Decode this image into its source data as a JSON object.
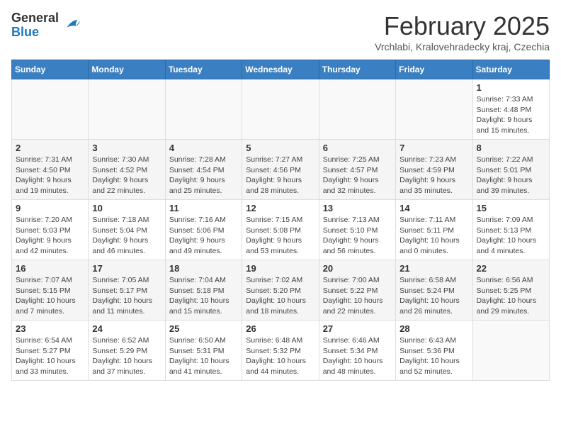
{
  "header": {
    "logo_general": "General",
    "logo_blue": "Blue",
    "month_year": "February 2025",
    "location": "Vrchlabi, Kralovehradecky kraj, Czechia"
  },
  "days_of_week": [
    "Sunday",
    "Monday",
    "Tuesday",
    "Wednesday",
    "Thursday",
    "Friday",
    "Saturday"
  ],
  "weeks": [
    [
      {
        "day": "",
        "info": ""
      },
      {
        "day": "",
        "info": ""
      },
      {
        "day": "",
        "info": ""
      },
      {
        "day": "",
        "info": ""
      },
      {
        "day": "",
        "info": ""
      },
      {
        "day": "",
        "info": ""
      },
      {
        "day": "1",
        "info": "Sunrise: 7:33 AM\nSunset: 4:48 PM\nDaylight: 9 hours and 15 minutes."
      }
    ],
    [
      {
        "day": "2",
        "info": "Sunrise: 7:31 AM\nSunset: 4:50 PM\nDaylight: 9 hours and 19 minutes."
      },
      {
        "day": "3",
        "info": "Sunrise: 7:30 AM\nSunset: 4:52 PM\nDaylight: 9 hours and 22 minutes."
      },
      {
        "day": "4",
        "info": "Sunrise: 7:28 AM\nSunset: 4:54 PM\nDaylight: 9 hours and 25 minutes."
      },
      {
        "day": "5",
        "info": "Sunrise: 7:27 AM\nSunset: 4:56 PM\nDaylight: 9 hours and 28 minutes."
      },
      {
        "day": "6",
        "info": "Sunrise: 7:25 AM\nSunset: 4:57 PM\nDaylight: 9 hours and 32 minutes."
      },
      {
        "day": "7",
        "info": "Sunrise: 7:23 AM\nSunset: 4:59 PM\nDaylight: 9 hours and 35 minutes."
      },
      {
        "day": "8",
        "info": "Sunrise: 7:22 AM\nSunset: 5:01 PM\nDaylight: 9 hours and 39 minutes."
      }
    ],
    [
      {
        "day": "9",
        "info": "Sunrise: 7:20 AM\nSunset: 5:03 PM\nDaylight: 9 hours and 42 minutes."
      },
      {
        "day": "10",
        "info": "Sunrise: 7:18 AM\nSunset: 5:04 PM\nDaylight: 9 hours and 46 minutes."
      },
      {
        "day": "11",
        "info": "Sunrise: 7:16 AM\nSunset: 5:06 PM\nDaylight: 9 hours and 49 minutes."
      },
      {
        "day": "12",
        "info": "Sunrise: 7:15 AM\nSunset: 5:08 PM\nDaylight: 9 hours and 53 minutes."
      },
      {
        "day": "13",
        "info": "Sunrise: 7:13 AM\nSunset: 5:10 PM\nDaylight: 9 hours and 56 minutes."
      },
      {
        "day": "14",
        "info": "Sunrise: 7:11 AM\nSunset: 5:11 PM\nDaylight: 10 hours and 0 minutes."
      },
      {
        "day": "15",
        "info": "Sunrise: 7:09 AM\nSunset: 5:13 PM\nDaylight: 10 hours and 4 minutes."
      }
    ],
    [
      {
        "day": "16",
        "info": "Sunrise: 7:07 AM\nSunset: 5:15 PM\nDaylight: 10 hours and 7 minutes."
      },
      {
        "day": "17",
        "info": "Sunrise: 7:05 AM\nSunset: 5:17 PM\nDaylight: 10 hours and 11 minutes."
      },
      {
        "day": "18",
        "info": "Sunrise: 7:04 AM\nSunset: 5:18 PM\nDaylight: 10 hours and 15 minutes."
      },
      {
        "day": "19",
        "info": "Sunrise: 7:02 AM\nSunset: 5:20 PM\nDaylight: 10 hours and 18 minutes."
      },
      {
        "day": "20",
        "info": "Sunrise: 7:00 AM\nSunset: 5:22 PM\nDaylight: 10 hours and 22 minutes."
      },
      {
        "day": "21",
        "info": "Sunrise: 6:58 AM\nSunset: 5:24 PM\nDaylight: 10 hours and 26 minutes."
      },
      {
        "day": "22",
        "info": "Sunrise: 6:56 AM\nSunset: 5:25 PM\nDaylight: 10 hours and 29 minutes."
      }
    ],
    [
      {
        "day": "23",
        "info": "Sunrise: 6:54 AM\nSunset: 5:27 PM\nDaylight: 10 hours and 33 minutes."
      },
      {
        "day": "24",
        "info": "Sunrise: 6:52 AM\nSunset: 5:29 PM\nDaylight: 10 hours and 37 minutes."
      },
      {
        "day": "25",
        "info": "Sunrise: 6:50 AM\nSunset: 5:31 PM\nDaylight: 10 hours and 41 minutes."
      },
      {
        "day": "26",
        "info": "Sunrise: 6:48 AM\nSunset: 5:32 PM\nDaylight: 10 hours and 44 minutes."
      },
      {
        "day": "27",
        "info": "Sunrise: 6:46 AM\nSunset: 5:34 PM\nDaylight: 10 hours and 48 minutes."
      },
      {
        "day": "28",
        "info": "Sunrise: 6:43 AM\nSunset: 5:36 PM\nDaylight: 10 hours and 52 minutes."
      },
      {
        "day": "",
        "info": ""
      }
    ]
  ]
}
